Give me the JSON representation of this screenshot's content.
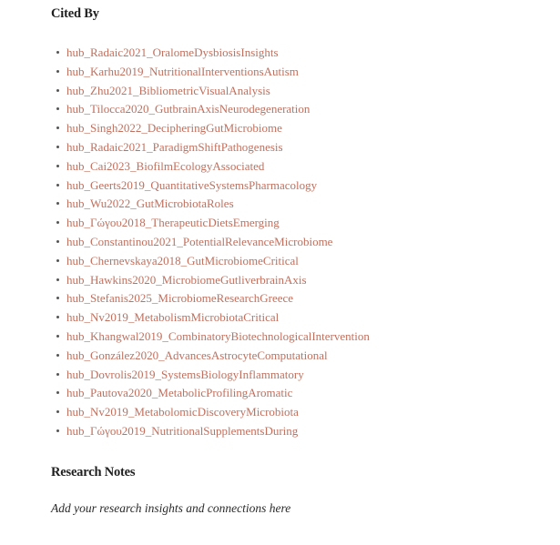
{
  "cited_by": {
    "heading": "Cited By",
    "items": [
      {
        "label": "hub_Radaic2021_OralomeDysbiosisInsights"
      },
      {
        "label": "hub_Karhu2019_NutritionalInterventionsAutism"
      },
      {
        "label": "hub_Zhu2021_BibliometricVisualAnalysis"
      },
      {
        "label": "hub_Tilocca2020_GutbrainAxisNeurodegeneration"
      },
      {
        "label": "hub_Singh2022_DecipheringGutMicrobiome"
      },
      {
        "label": "hub_Radaic2021_ParadigmShiftPathogenesis"
      },
      {
        "label": "hub_Cai2023_BiofilmEcologyAssociated"
      },
      {
        "label": "hub_Geerts2019_QuantitativeSystemsPharmacology"
      },
      {
        "label": "hub_Wu2022_GutMicrobiotaRoles"
      },
      {
        "label": "hub_Γώγου2018_TherapeuticDietsEmerging"
      },
      {
        "label": "hub_Constantinou2021_PotentialRelevanceMicrobiome"
      },
      {
        "label": "hub_Chernevskaya2018_GutMicrobiomeCritical"
      },
      {
        "label": "hub_Hawkins2020_MicrobiomeGutliverbrainAxis"
      },
      {
        "label": "hub_Stefanis2025_MicrobiomeResearchGreece"
      },
      {
        "label": "hub_Nv2019_MetabolismMicrobiotaCritical"
      },
      {
        "label": "hub_Khangwal2019_CombinatoryBiotechnologicalIntervention"
      },
      {
        "label": "hub_González2020_AdvancesAstrocyteComputational"
      },
      {
        "label": "hub_Dovrolis2019_SystemsBiologyInflammatory"
      },
      {
        "label": "hub_Pautova2020_MetabolicProfilingAromatic"
      },
      {
        "label": "hub_Nv2019_MetabolomicDiscoveryMicrobiota"
      },
      {
        "label": "hub_Γώγου2019_NutritionalSupplementsDuring"
      }
    ]
  },
  "research_notes": {
    "heading": "Research Notes",
    "placeholder_text": "Add your research insights and connections here"
  },
  "colors": {
    "link": "#c0705e",
    "heading": "#1f1f1f",
    "bullet": "#555555"
  }
}
